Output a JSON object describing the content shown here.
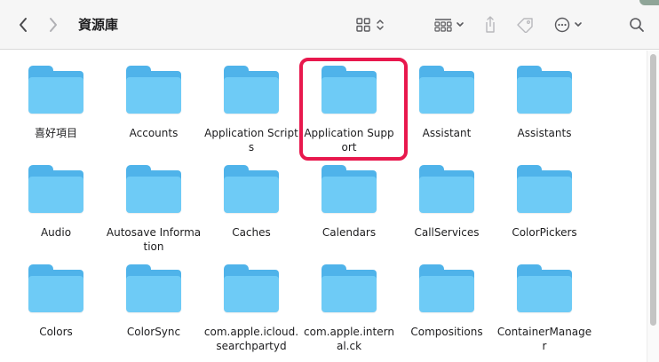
{
  "toolbar": {
    "title": "資源庫",
    "back_icon": "chevron-left-icon",
    "forward_icon": "chevron-right-icon",
    "view_icon": "grid-view-icon",
    "group_icon": "group-icon",
    "share_icon": "share-icon",
    "tag_icon": "tag-icon",
    "more_icon": "ellipsis-icon",
    "search_icon": "search-icon"
  },
  "colors": {
    "highlight": "#e8184d",
    "folder_back": "#4fb3ea",
    "folder_front": "#6ecbf6"
  },
  "folders": [
    {
      "label": "喜好項目"
    },
    {
      "label": "Accounts"
    },
    {
      "label": "Application Scripts"
    },
    {
      "label": "Application Support",
      "highlighted": true
    },
    {
      "label": "Assistant"
    },
    {
      "label": "Assistants"
    },
    {
      "label": "Audio"
    },
    {
      "label": "Autosave Information"
    },
    {
      "label": "Caches"
    },
    {
      "label": "Calendars"
    },
    {
      "label": "CallServices"
    },
    {
      "label": "ColorPickers"
    },
    {
      "label": "Colors"
    },
    {
      "label": "ColorSync"
    },
    {
      "label": "com.apple.icloud.searchpartyd"
    },
    {
      "label": "com.apple.internal.ck"
    },
    {
      "label": "Compositions"
    },
    {
      "label": "ContainerManager"
    }
  ]
}
